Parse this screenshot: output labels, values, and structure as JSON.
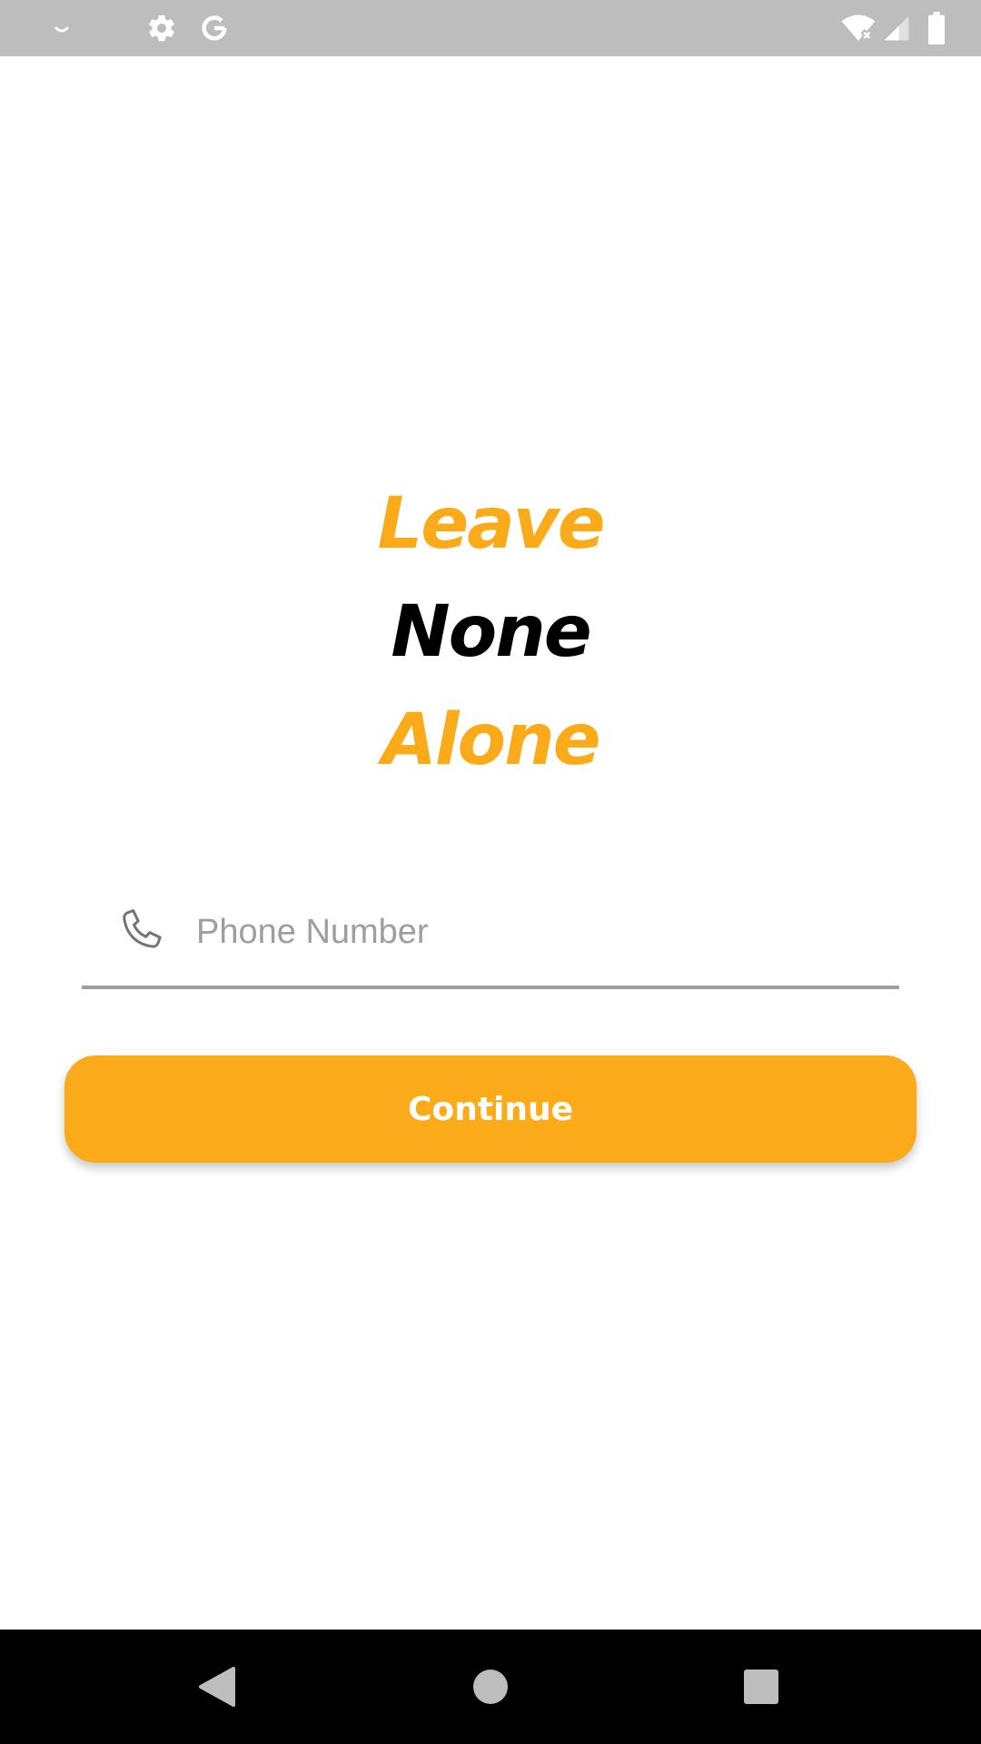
{
  "status_bar": {
    "left_icons": [
      "notification-dot-icon",
      "settings-gear-icon",
      "google-g-icon"
    ],
    "right_icons": [
      "wifi-no-internet-icon",
      "cell-signal-icon",
      "battery-icon"
    ]
  },
  "slogan": {
    "line1": "Leave",
    "line2": "None",
    "line3": "Alone"
  },
  "phone_input": {
    "placeholder": "Phone Number",
    "value": "",
    "icon": "phone-icon"
  },
  "continue_button": {
    "label": "Continue"
  },
  "nav_bar": {
    "buttons": [
      "back-icon",
      "home-icon",
      "recents-icon"
    ]
  },
  "colors": {
    "accent": "#fbaa1a",
    "status_bar": "#bdbdbd",
    "nav_bar": "#000000",
    "underline": "#9e9e9e"
  }
}
